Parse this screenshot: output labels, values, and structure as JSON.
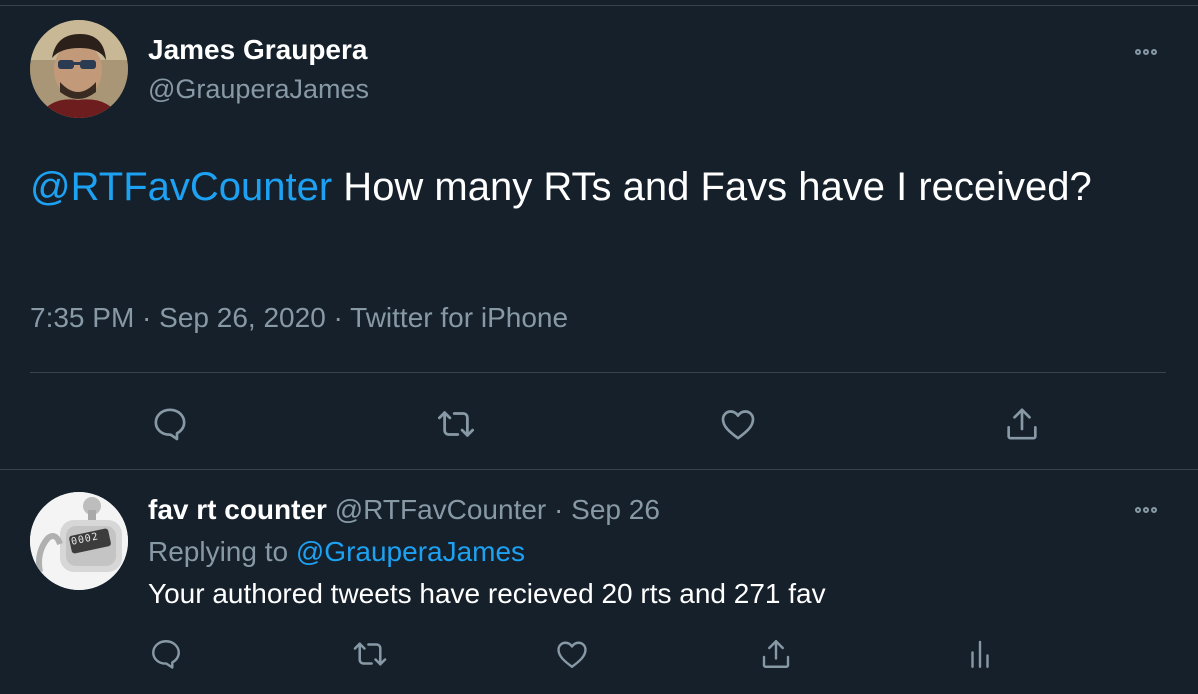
{
  "main_tweet": {
    "author_name": "James Graupera",
    "author_handle": "@GrauperaJames",
    "mention": "@RTFavCounter",
    "text": " How many RTs and Favs have I received?",
    "time": "7:35 PM",
    "date": "Sep 26, 2020",
    "source": "Twitter for iPhone",
    "separator": " · "
  },
  "reply_tweet": {
    "author_name": "fav rt counter",
    "author_handle": "@RTFavCounter",
    "separator": " · ",
    "date": "Sep 26",
    "replying_prefix": "Replying to ",
    "replying_to": "@GrauperaJames",
    "text": "Your authored tweets have recieved 20 rts and 271 fav",
    "counter_display": "0002"
  },
  "icons": {
    "reply": "reply-icon",
    "retweet": "retweet-icon",
    "like": "heart-icon",
    "share": "share-icon",
    "analytics": "analytics-icon",
    "more": "more-icon"
  },
  "colors": {
    "background": "#15202b",
    "accent": "#1da1f2",
    "secondary_text": "#8899a6",
    "divider": "#38444d"
  }
}
